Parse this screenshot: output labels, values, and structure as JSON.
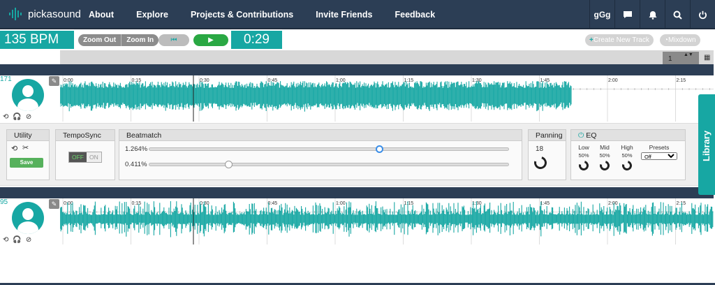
{
  "nav": {
    "brand": "pickasound",
    "links": [
      "About",
      "Explore",
      "Projects & Contributions",
      "Invite Friends",
      "Feedback"
    ],
    "user_initials": "gGg"
  },
  "transport": {
    "bpm": "135 BPM",
    "zoom_out": "Zoom Out",
    "zoom_in": "Zoom In",
    "rewind_glyph": "⏮",
    "play_glyph": "▶",
    "time": "0:29",
    "create_track": "Create New Track",
    "mixdown": "Mixdown"
  },
  "selector_value": "1",
  "timeline_labels": [
    "0:00",
    "0:15",
    "0:30",
    "0:45",
    "1:00",
    "1:15",
    "1:30",
    "1:45",
    "2:00",
    "2:15"
  ],
  "tracks": [
    {
      "number": "171",
      "wave_length_fraction": 0.79
    },
    {
      "number": "95",
      "wave_length_fraction": 1.0
    }
  ],
  "panel": {
    "utility_label": "Utility",
    "save_label": "Save",
    "temposync_label": "TempoSync",
    "off_label": "OFF",
    "on_label": "ON",
    "beatmatch_label": "Beatmatch",
    "slider1_value": "1.264%",
    "slider1_position": 0.64,
    "slider2_value": "0.411%",
    "slider2_position": 0.22,
    "panning_label": "Panning",
    "panning_value": "18",
    "eq_label": "EQ",
    "eq_low": "Low",
    "eq_mid": "Mid",
    "eq_high": "High",
    "eq_low_pct": "50%",
    "eq_mid_pct": "50%",
    "eq_high_pct": "50%",
    "presets_label": "Presets",
    "preset_value": "Off"
  },
  "library_label": "Library",
  "colors": {
    "teal": "#17a7a3",
    "navy": "#2c3e55",
    "green": "#2aa843"
  }
}
